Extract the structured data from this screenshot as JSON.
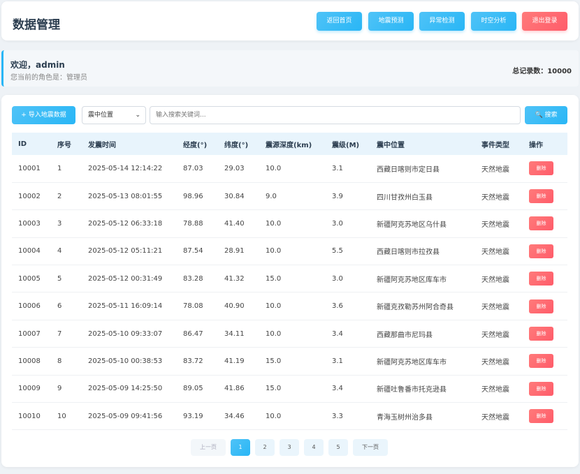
{
  "header": {
    "title": "数据管理",
    "nav": [
      {
        "label": "返回首页",
        "name": "home-button"
      },
      {
        "label": "地震预测",
        "name": "prediction-button"
      },
      {
        "label": "异常检测",
        "name": "anomaly-button"
      },
      {
        "label": "时空分析",
        "name": "spatiotemporal-button"
      },
      {
        "label": "退出登录",
        "name": "logout-button"
      }
    ]
  },
  "welcome": {
    "greeting": "欢迎，admin",
    "role": "您当前的角色是：管理员",
    "total": "总记录数：10000"
  },
  "toolbar": {
    "import_label": "+ 导入地震数据",
    "select_value": "震中位置",
    "search_placeholder": "输入搜索关键词...",
    "search_label": "🔍 搜索"
  },
  "table": {
    "columns": [
      "ID",
      "序号",
      "发震时间",
      "经度(°)",
      "纬度(°)",
      "震源深度(km)",
      "震级(M)",
      "震中位置",
      "事件类型",
      "操作"
    ],
    "delete_label": "删除",
    "rows": [
      [
        "10001",
        "1",
        "2025-05-14 12:14:22",
        "87.03",
        "29.03",
        "10.0",
        "3.1",
        "西藏日喀则市定日县",
        "天然地震"
      ],
      [
        "10002",
        "2",
        "2025-05-13 08:01:55",
        "98.96",
        "30.84",
        "9.0",
        "3.9",
        "四川甘孜州白玉县",
        "天然地震"
      ],
      [
        "10003",
        "3",
        "2025-05-12 06:33:18",
        "78.88",
        "41.40",
        "10.0",
        "3.0",
        "新疆阿克苏地区乌什县",
        "天然地震"
      ],
      [
        "10004",
        "4",
        "2025-05-12 05:11:21",
        "87.54",
        "28.91",
        "10.0",
        "5.5",
        "西藏日喀则市拉孜县",
        "天然地震"
      ],
      [
        "10005",
        "5",
        "2025-05-12 00:31:49",
        "83.28",
        "41.32",
        "15.0",
        "3.0",
        "新疆阿克苏地区库车市",
        "天然地震"
      ],
      [
        "10006",
        "6",
        "2025-05-11 16:09:14",
        "78.08",
        "40.90",
        "10.0",
        "3.6",
        "新疆克孜勒苏州阿合奇县",
        "天然地震"
      ],
      [
        "10007",
        "7",
        "2025-05-10 09:33:07",
        "86.47",
        "34.11",
        "10.0",
        "3.4",
        "西藏那曲市尼玛县",
        "天然地震"
      ],
      [
        "10008",
        "8",
        "2025-05-10 00:38:53",
        "83.72",
        "41.19",
        "15.0",
        "3.1",
        "新疆阿克苏地区库车市",
        "天然地震"
      ],
      [
        "10009",
        "9",
        "2025-05-09 14:25:50",
        "89.05",
        "41.86",
        "15.0",
        "3.4",
        "新疆吐鲁番市托克逊县",
        "天然地震"
      ],
      [
        "10010",
        "10",
        "2025-05-09 09:41:56",
        "93.19",
        "34.46",
        "10.0",
        "3.3",
        "青海玉树州治多县",
        "天然地震"
      ]
    ]
  },
  "pagination": {
    "prev": "上一页",
    "pages": [
      "1",
      "2",
      "3",
      "4",
      "5"
    ],
    "current": "1",
    "next": "下一页"
  }
}
